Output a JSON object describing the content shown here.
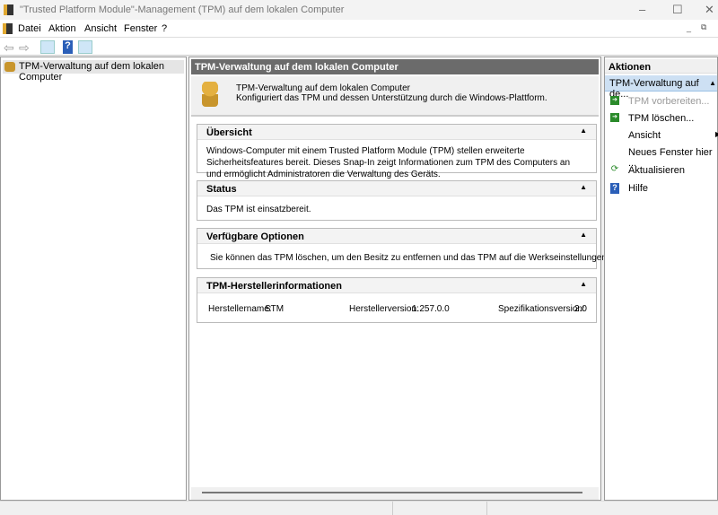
{
  "window": {
    "title": "\"Trusted Platform Module\"-Management (TPM) auf dem lokalen Computer"
  },
  "menu": [
    "Datei",
    "Aktion",
    "Ansicht",
    "Fenster",
    "?"
  ],
  "tree": {
    "root": "TPM-Verwaltung auf dem lokalen Computer"
  },
  "center": {
    "header": "TPM-Verwaltung auf dem lokalen Computer",
    "intro_title": "TPM-Verwaltung auf dem lokalen Computer",
    "intro_desc": "Konfiguriert das TPM und dessen Unterstützung durch die Windows-Plattform.",
    "sections": {
      "overview": {
        "title": "Übersicht",
        "body": "Windows-Computer mit einem Trusted Platform Module (TPM) stellen erweiterte Sicherheitsfeatures bereit. Dieses Snap-In zeigt Informationen zum TPM des Computers an und ermöglicht Administratoren die Verwaltung des Geräts."
      },
      "status": {
        "title": "Status",
        "body": "Das TPM ist einsatzbereit."
      },
      "options": {
        "title": "Verfügbare Optionen",
        "body": "Sie können das TPM löschen, um den Besitz zu entfernen und das TPM auf die Werkseinstellungen zurückzusetzen."
      },
      "vendor": {
        "title": "TPM-Herstellerinformationen",
        "name_label": "Herstellername:",
        "name": "STM",
        "version_label": "Herstellerversion:",
        "version": "1.257.0.0",
        "spec_label": "Spezifikationsversion:",
        "spec": "2.0"
      }
    }
  },
  "actions": {
    "header": "Aktionen",
    "group": "TPM-Verwaltung auf de...",
    "items": [
      "TPM vorbereiten...",
      "TPM löschen...",
      "Ansicht",
      "Neues Fenster hier ...",
      "Aktualisieren",
      "Hilfe"
    ]
  }
}
